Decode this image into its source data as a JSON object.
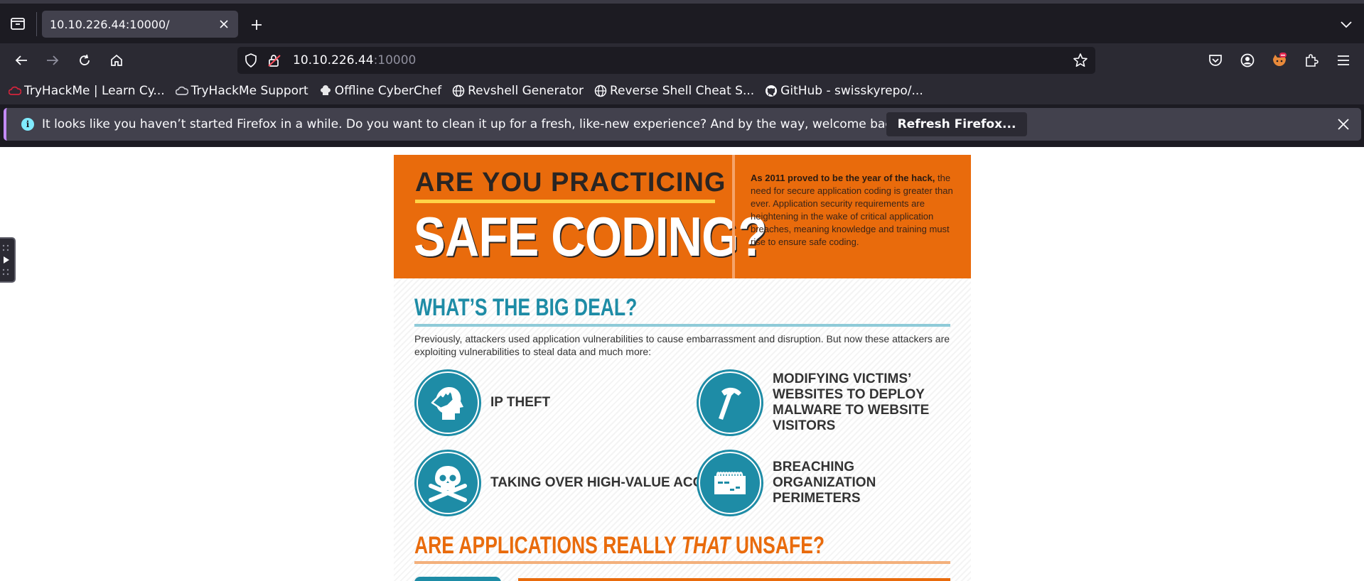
{
  "browser": {
    "tab": {
      "title": "10.10.226.44:10000/"
    },
    "url": {
      "host": "10.10.226.44",
      "port": ":10000"
    },
    "bookmarks": [
      "TryHackMe | Learn Cy...",
      "TryHackMe Support",
      "Offline CyberChef",
      "Revshell Generator",
      "Reverse Shell Cheat S...",
      "GitHub - swisskyrepo/..."
    ],
    "notification": {
      "message": "It looks like you haven’t started Firefox in a while. Do you want to clean it up for a fresh, like-new experience? And by the way, welcome back!",
      "button": "Refresh Firefox..."
    }
  },
  "poster": {
    "header_line1": "ARE YOU PRACTICING",
    "header_line2": "SAFE CODING?",
    "blurb_bold": "As 2011 proved to be the year of the hack,",
    "blurb_rest": "the need for secure application coding is greater than ever. Application security requirements are heightening in the wake of critical application breaches, meaning knowledge and training must rise to ensure safe coding.",
    "section1_title": "WHAT’S THE BIG DEAL?",
    "section1_intro": "Previously, attackers used application vulnerabilities to cause embarrassment and disruption. But now these attackers are exploiting vulnerabilities to steal data and much more:",
    "threats": [
      "IP THEFT",
      "MODIFYING VICTIMS’ WEBSITES TO DEPLOY MALWARE TO WEBSITE VISITORS",
      "TAKING OVER HIGH-VALUE ACCOUNTS",
      "BREACHING ORGANIZATION PERIMETERS"
    ],
    "section2_title_a": "ARE APPLICATIONS REALLY ",
    "section2_title_em": "THAT",
    "section2_title_b": " UNSAFE?"
  },
  "colors": {
    "chrome_bg": "#1c1b22",
    "toolbar_bg": "#2b2a33",
    "poster_orange": "#e96b0c",
    "poster_teal": "#1e8ca6"
  }
}
